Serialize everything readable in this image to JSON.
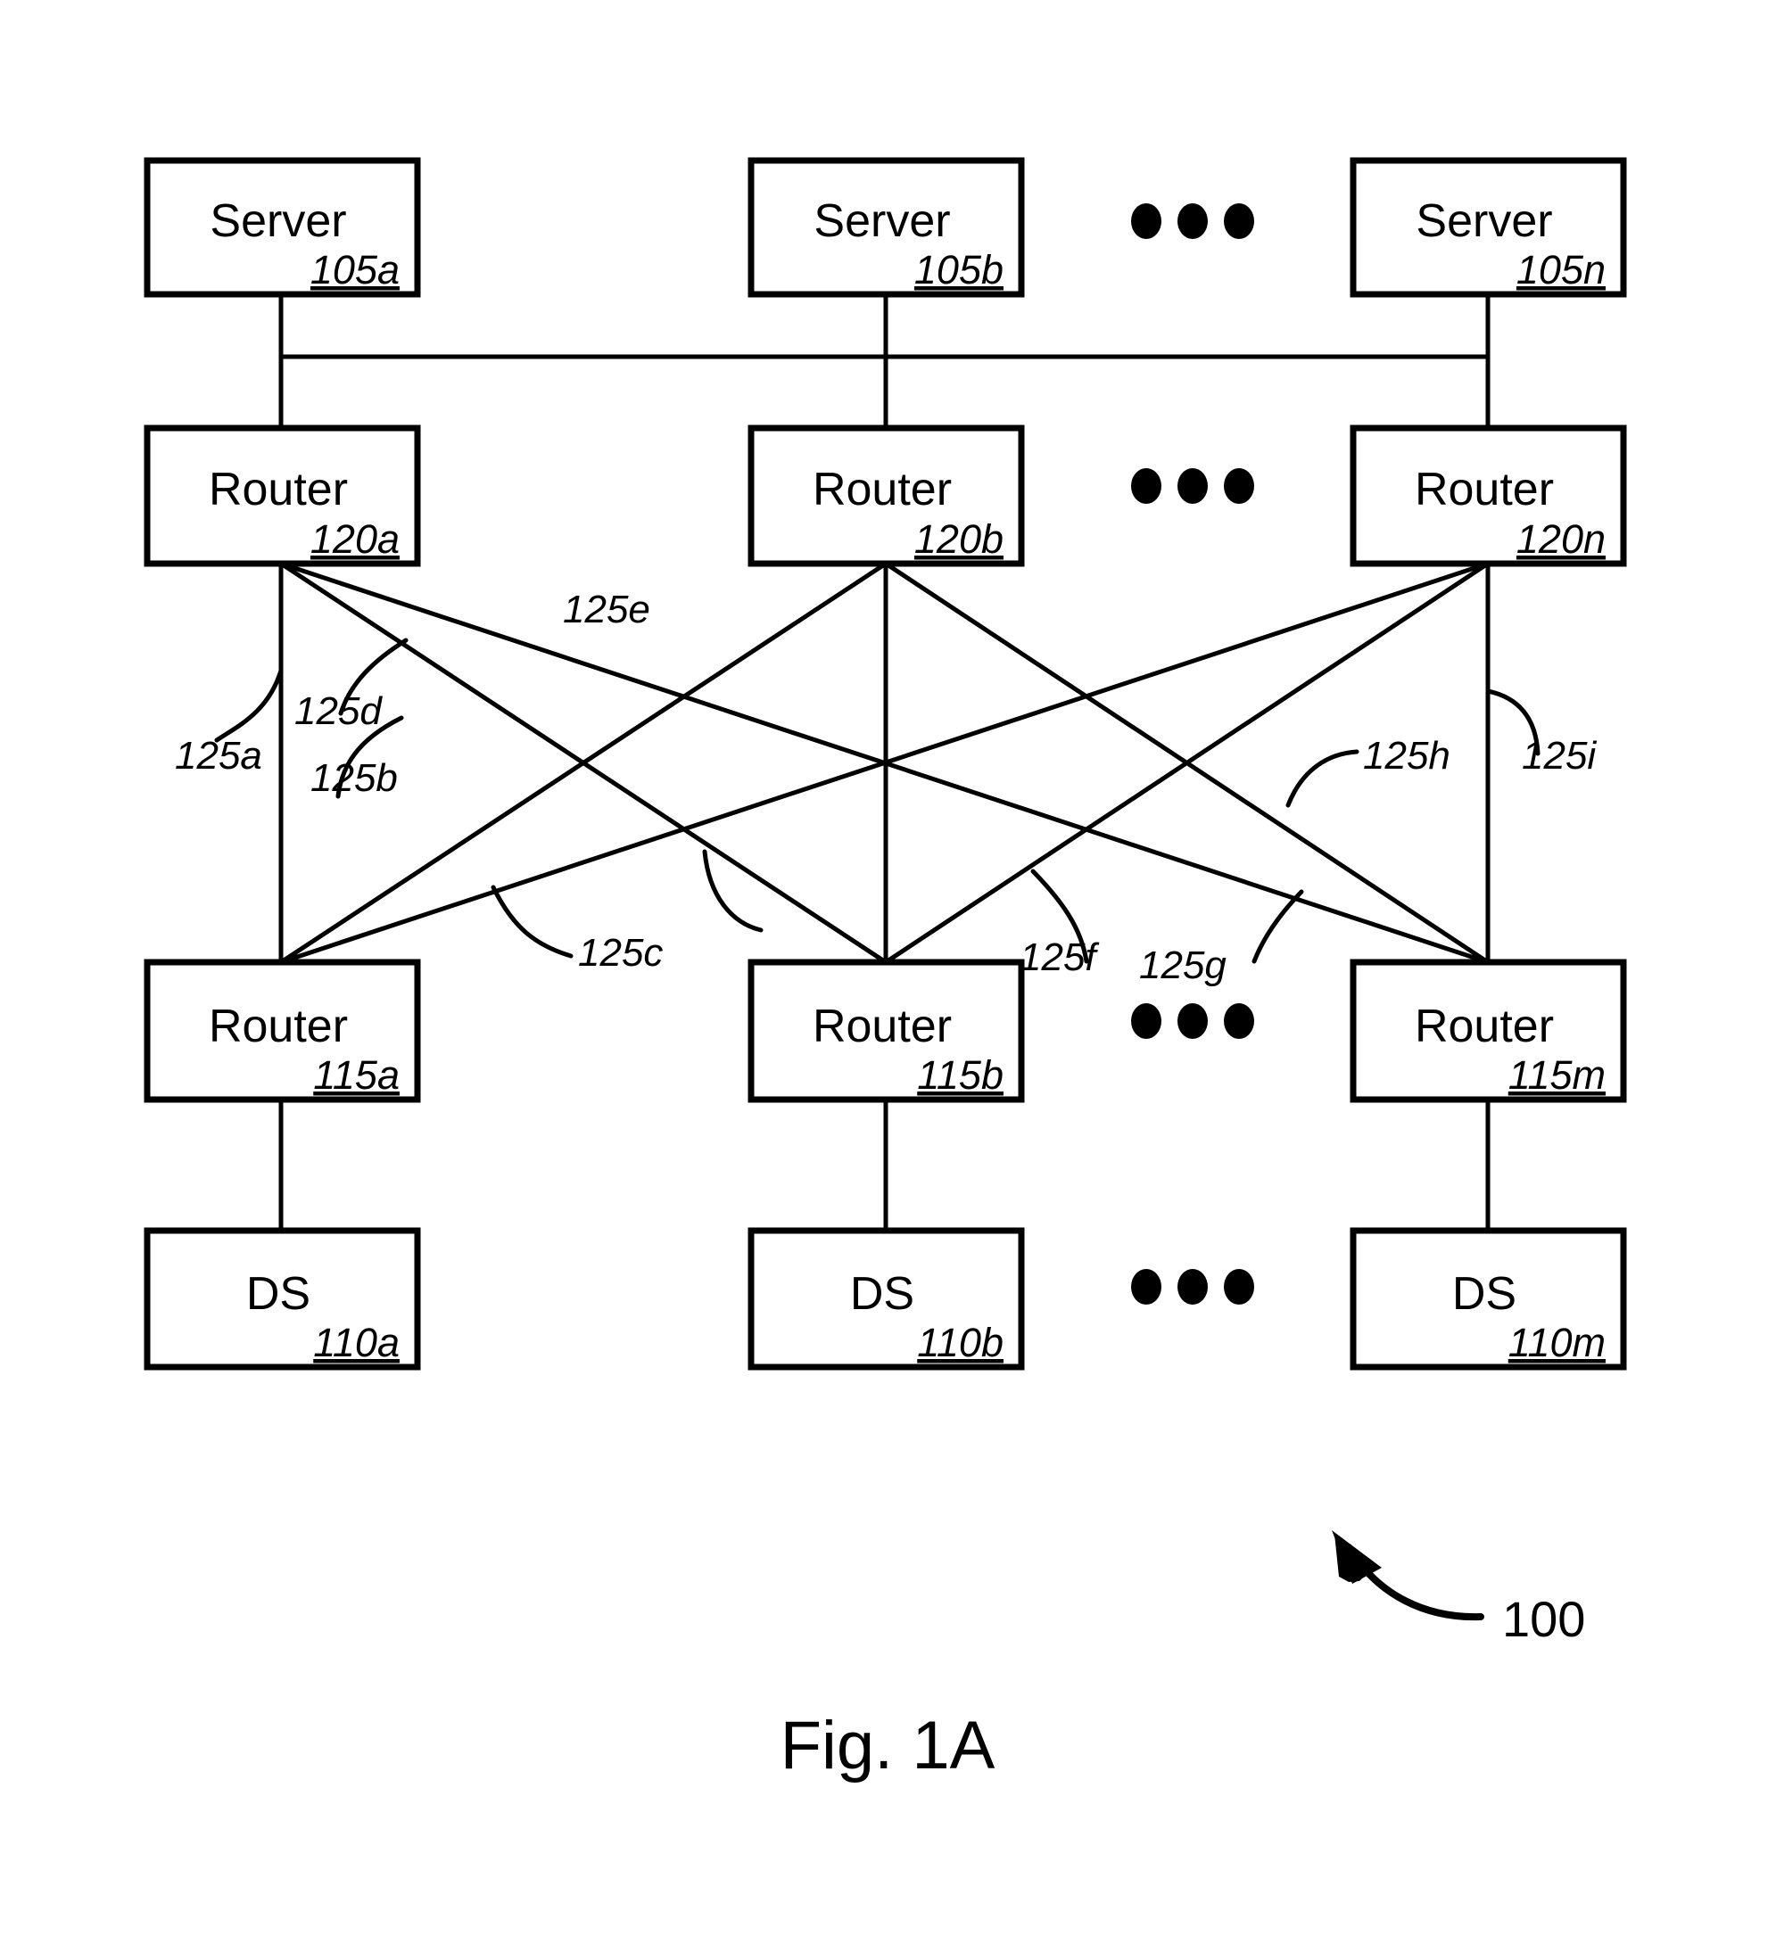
{
  "figure": {
    "caption": "Fig. 1A",
    "system_ref": "100"
  },
  "nodes": {
    "servers": [
      {
        "label": "Server",
        "ref": "105a"
      },
      {
        "label": "Server",
        "ref": "105b"
      },
      {
        "label": "Server",
        "ref": "105n"
      }
    ],
    "upper_routers": [
      {
        "label": "Router",
        "ref": "120a"
      },
      {
        "label": "Router",
        "ref": "120b"
      },
      {
        "label": "Router",
        "ref": "120n"
      }
    ],
    "lower_routers": [
      {
        "label": "Router",
        "ref": "115a"
      },
      {
        "label": "Router",
        "ref": "115b"
      },
      {
        "label": "Router",
        "ref": "115m"
      }
    ],
    "data_stores": [
      {
        "label": "DS",
        "ref": "110a"
      },
      {
        "label": "DS",
        "ref": "110b"
      },
      {
        "label": "DS",
        "ref": "110m"
      }
    ]
  },
  "link_labels": [
    {
      "ref": "125a"
    },
    {
      "ref": "125b"
    },
    {
      "ref": "125c"
    },
    {
      "ref": "125d"
    },
    {
      "ref": "125e"
    },
    {
      "ref": "125f"
    },
    {
      "ref": "125g"
    },
    {
      "ref": "125h"
    },
    {
      "ref": "125i"
    }
  ],
  "colors": {
    "background": "#ffffff",
    "stroke": "#000000",
    "text": "#000000"
  }
}
